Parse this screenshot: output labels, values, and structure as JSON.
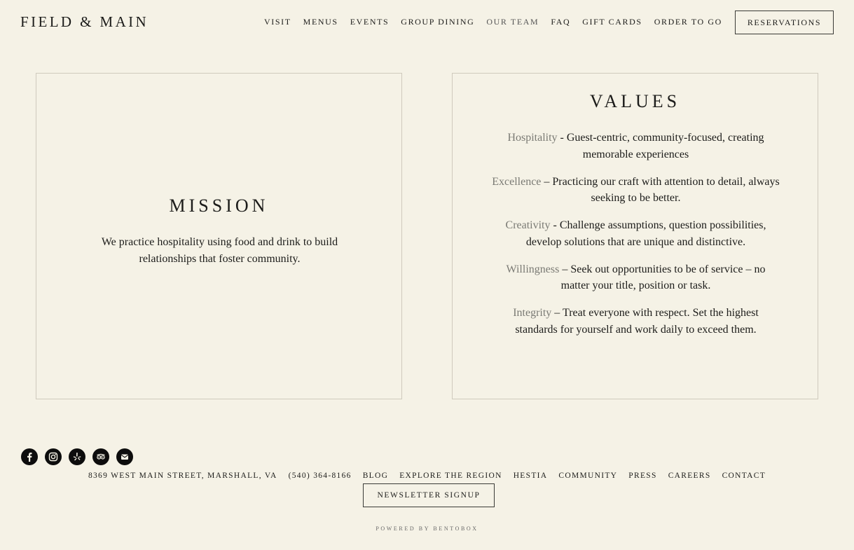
{
  "logo": "FIELD & MAIN",
  "nav": [
    {
      "label": "VISIT"
    },
    {
      "label": "MENUS"
    },
    {
      "label": "EVENTS"
    },
    {
      "label": "GROUP DINING"
    },
    {
      "label": "OUR TEAM"
    },
    {
      "label": "FAQ"
    },
    {
      "label": "GIFT CARDS"
    },
    {
      "label": "ORDER TO GO"
    }
  ],
  "reservations_label": "RESERVATIONS",
  "mission": {
    "title": "MISSION",
    "text": "We practice hospitality using food and drink to build relationships that foster community."
  },
  "values": {
    "title": "VALUES",
    "items": [
      {
        "term": "Hospitality",
        "text": " - Guest-centric, community-focused, creating memorable experiences"
      },
      {
        "term": "Excellence",
        "text": " – Practicing our craft with attention to detail, always seeking to be better."
      },
      {
        "term": "Creativity",
        "text": " - Challenge assumptions, question possibilities, develop solutions that are unique and distinctive."
      },
      {
        "term": "Willingness",
        "text": " – Seek out opportunities to be of service – no matter your title, position or task."
      },
      {
        "term": "Integrity",
        "text": " – Treat everyone with respect. Set the highest standards for yourself and work daily to exceed them."
      }
    ]
  },
  "social_icons": [
    "facebook-icon",
    "instagram-icon",
    "yelp-icon",
    "tripadvisor-icon",
    "email-icon"
  ],
  "footer": {
    "links": [
      "8369 WEST MAIN STREET, MARSHALL, VA",
      "(540) 364-8166",
      "BLOG",
      "EXPLORE THE REGION",
      "HESTIA",
      "COMMUNITY",
      "PRESS",
      "CAREERS",
      "CONTACT"
    ],
    "newsletter_label": "NEWSLETTER SIGNUP",
    "powered_by": "POWERED BY BENTOBOX"
  },
  "colors": {
    "background": "#f5f2e6",
    "text": "#1c1c1a",
    "muted_term": "#7a7a74",
    "border": "#cfcabd"
  }
}
